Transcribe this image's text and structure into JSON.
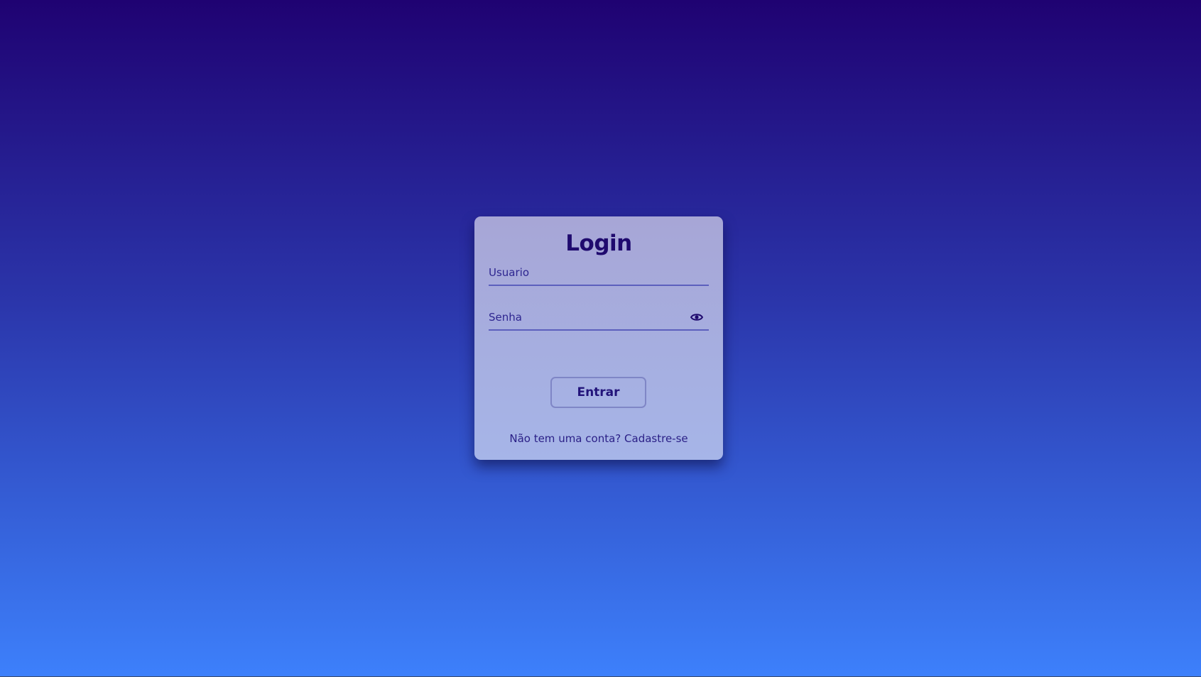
{
  "login": {
    "title": "Login",
    "username": {
      "value": "",
      "placeholder": "Usuario"
    },
    "password": {
      "value": "",
      "placeholder": "Senha"
    },
    "show_password_icon": "eye-icon",
    "submit_label": "Entrar",
    "signup_prompt": "Não tem uma conta?",
    "signup_link": "Cadastre-se"
  },
  "colors": {
    "background_top": "#1f0272",
    "background_bottom": "#3d80fb",
    "card": "#a7a6d6",
    "accent": "#1f0a6e"
  }
}
